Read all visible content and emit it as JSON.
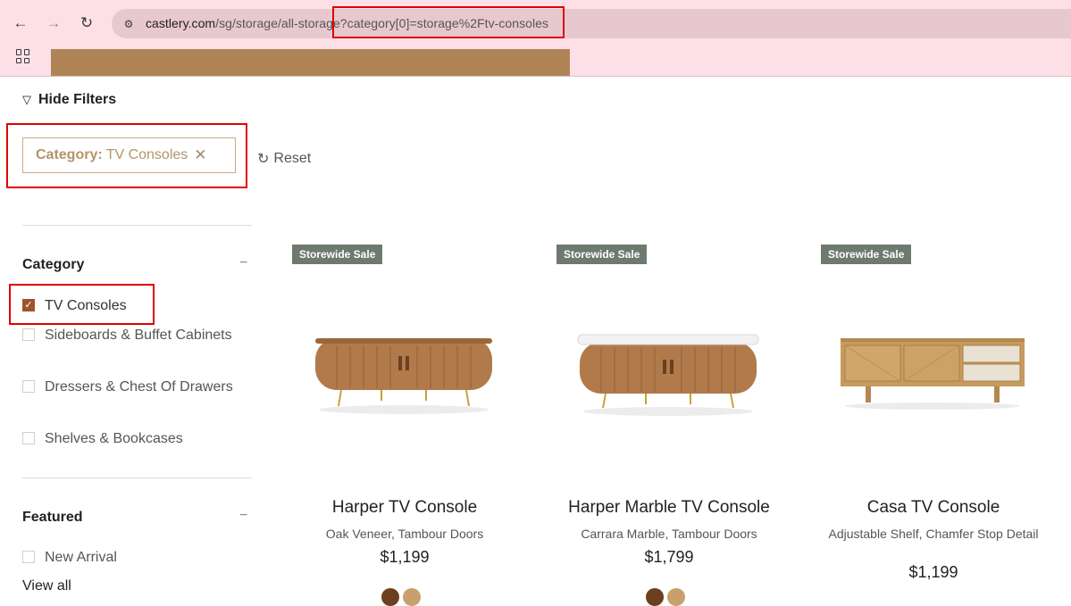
{
  "browser": {
    "url_host": "castlery.com",
    "url_path": "/sg/storage/all-storage?category[0]=storage%2Ftv-consoles"
  },
  "filters": {
    "hide_label": "Hide Filters",
    "active_chip_key": "Category:",
    "active_chip_value": "TV Consoles",
    "reset_label": "Reset"
  },
  "category": {
    "title": "Category",
    "toggle": "−",
    "options": [
      {
        "label": "TV Consoles",
        "checked": true
      },
      {
        "label": "Sideboards & Buffet Cabinets",
        "checked": false
      },
      {
        "label": "Dressers & Chest Of Drawers",
        "checked": false
      },
      {
        "label": "Shelves & Bookcases",
        "checked": false
      }
    ]
  },
  "featured": {
    "title": "Featured",
    "toggle": "−",
    "options": [
      {
        "label": "New Arrival",
        "checked": false
      }
    ],
    "view_all": "View all"
  },
  "products": [
    {
      "badge": "Storewide Sale",
      "name": "Harper TV Console",
      "desc": "Oak Veneer, Tambour Doors",
      "price": "$1,199",
      "swatches": [
        "#6b3f1f",
        "#c9a06b"
      ]
    },
    {
      "badge": "Storewide Sale",
      "name": "Harper Marble TV Console",
      "desc": "Carrara Marble, Tambour Doors",
      "price": "$1,799",
      "swatches": [
        "#6b3f1f",
        "#c9a06b"
      ]
    },
    {
      "badge": "Storewide Sale",
      "name": "Casa TV Console",
      "desc": "Adjustable Shelf, Chamfer Stop Detail",
      "price": "$1,199",
      "swatches": []
    }
  ],
  "colors": {
    "chrome_bg": "#fde0e7",
    "accent_gold": "#b39468",
    "checkbox_checked": "#a0532b",
    "badge_bg": "#6f7a6f",
    "highlight": "#e00000"
  }
}
